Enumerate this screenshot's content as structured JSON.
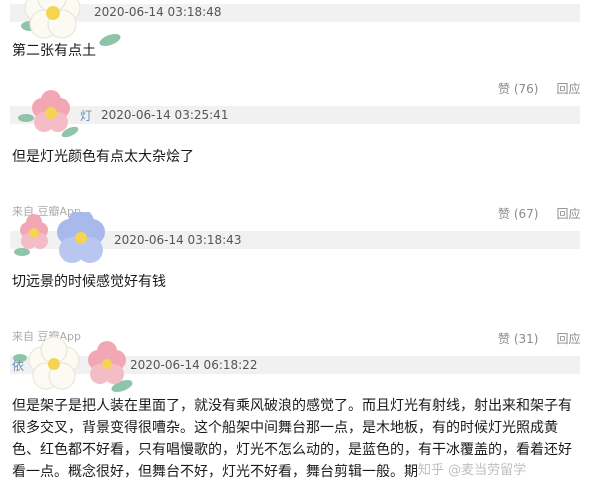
{
  "comments": [
    {
      "name": "",
      "timestamp": "2020-06-14 03:18:48",
      "text": "第二张有点土",
      "likes": "赞 (76)",
      "reply": "回应"
    },
    {
      "name": "灯",
      "timestamp": "2020-06-14 03:25:41",
      "text": "但是灯光颜色有点太大杂烩了",
      "source": "来自 豆瓣App",
      "likes": "赞 (67)",
      "reply": "回应"
    },
    {
      "name": "",
      "timestamp": "2020-06-14 03:18:43",
      "text": "切远景的时候感觉好有钱",
      "source": "来自 豆瓣App",
      "likes": "赞 (31)",
      "reply": "回应"
    },
    {
      "name": "依",
      "timestamp": "2020-06-14 06:18:22",
      "text": "但是架子是把人装在里面了，就没有乘风破浪的感觉了。而且灯光有射线，射出来和架子有很多交叉，背景变得很嘈杂。这个船架中间舞台那一点，是木地板，有的时候灯光照成黄色、红色都不好看，只有唱慢歌的，灯光不怎么动的，是蓝色的，有干冰覆盖的，看着还好看一点。概念很好，但舞台不好，灯光不好看，舞台剪辑一般。期"
    }
  ],
  "watermark": "知乎 @麦当劳留学",
  "flower_colors": {
    "white": "#fbfaf3",
    "pink": "#f1a7b4",
    "blue": "#aab9ec",
    "leaf": "#8fc4a8",
    "center": "#f5d451"
  }
}
